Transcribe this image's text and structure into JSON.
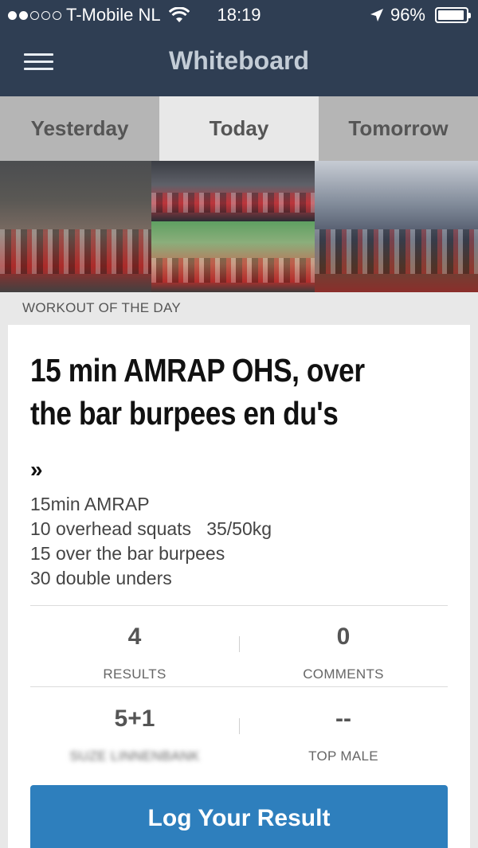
{
  "status_bar": {
    "carrier": "T-Mobile NL",
    "time": "18:19",
    "battery": "96%",
    "battery_level": 0.96,
    "signal_bars_filled": 2,
    "signal_bars_total": 5,
    "icons": [
      "wifi-icon",
      "location-arrow-icon",
      "battery-icon"
    ]
  },
  "nav": {
    "title": "Whiteboard",
    "menu_icon": "hamburger-menu-icon"
  },
  "tabs": [
    {
      "label": "Yesterday",
      "active": false
    },
    {
      "label": "Today",
      "active": true
    },
    {
      "label": "Tomorrow",
      "active": false
    }
  ],
  "section": {
    "label": "WORKOUT OF THE DAY"
  },
  "workout": {
    "title": "15 min AMRAP OHS, over the bar burpees en du's",
    "more_icon": "»",
    "lines": [
      "15min AMRAP",
      "10 overhead squats   35/50kg",
      "15 over the bar burpees",
      "30 double unders"
    ]
  },
  "stats": {
    "results": {
      "value": "4",
      "label": "RESULTS"
    },
    "comments": {
      "value": "0",
      "label": "COMMENTS"
    },
    "top_female": {
      "value": "5+1",
      "label": "SUZE LINNENBANK"
    },
    "top_male": {
      "value": "--",
      "label": "TOP MALE"
    }
  },
  "actions": {
    "log_result": "Log Your Result"
  },
  "colors": {
    "nav_bg": "#2f3e53",
    "tab_bg": "#b5b5b5",
    "tab_active_bg": "#e8e8e8",
    "button_bg": "#2e7fbd"
  }
}
